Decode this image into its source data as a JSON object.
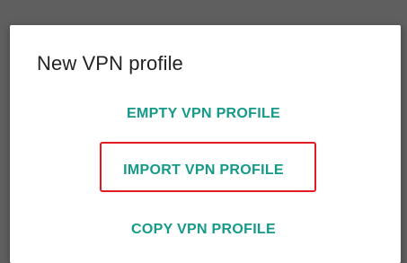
{
  "dialog": {
    "title": "New VPN profile",
    "options": [
      {
        "label": "EMPTY VPN PROFILE"
      },
      {
        "label": "IMPORT VPN PROFILE",
        "highlighted": true
      },
      {
        "label": "COPY VPN PROFILE"
      }
    ]
  },
  "colors": {
    "accent": "#159a8a",
    "highlight": "#e21a22",
    "backdrop": "#5f5f5f",
    "dialog_bg": "#ffffff",
    "title_text": "#222222"
  }
}
